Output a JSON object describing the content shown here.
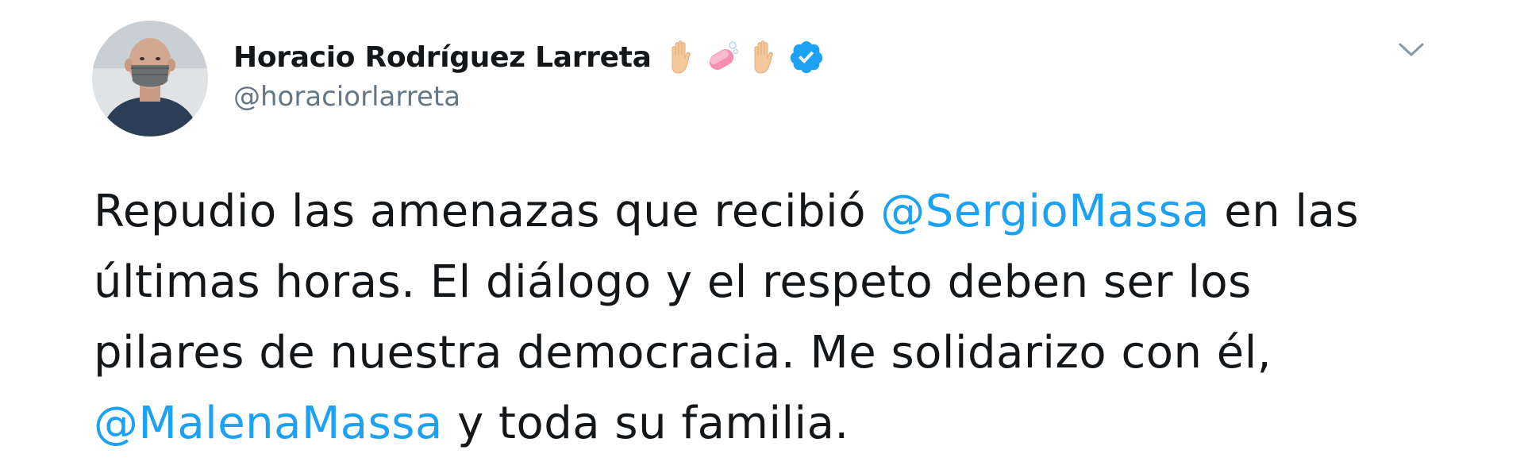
{
  "author": {
    "display_name": "Horacio Rodríguez Larreta",
    "handle": "@horaciorlarreta",
    "emoji": [
      "raised-hand-light-skin-tone",
      "soap",
      "raised-hand-light-skin-tone"
    ],
    "verified": true
  },
  "tweet": {
    "lines": [
      {
        "before": "Repudio las amenazas que recibió ",
        "mention": "@SergioMassa",
        "after": " en las"
      },
      {
        "before": "últimas horas. El diálogo y el respeto deben ser los",
        "mention": "",
        "after": ""
      },
      {
        "before": "pilares de nuestra democracia. Me solidarizo con él,",
        "mention": "",
        "after": ""
      },
      {
        "before": "",
        "mention": "@MalenaMassa",
        "after": " y toda su familia."
      }
    ]
  },
  "menu": {
    "icon": "chevron-down-icon"
  },
  "colors": {
    "text": "#14171a",
    "secondary": "#657786",
    "link": "#1da1f2",
    "verified": "#1da1f2"
  }
}
